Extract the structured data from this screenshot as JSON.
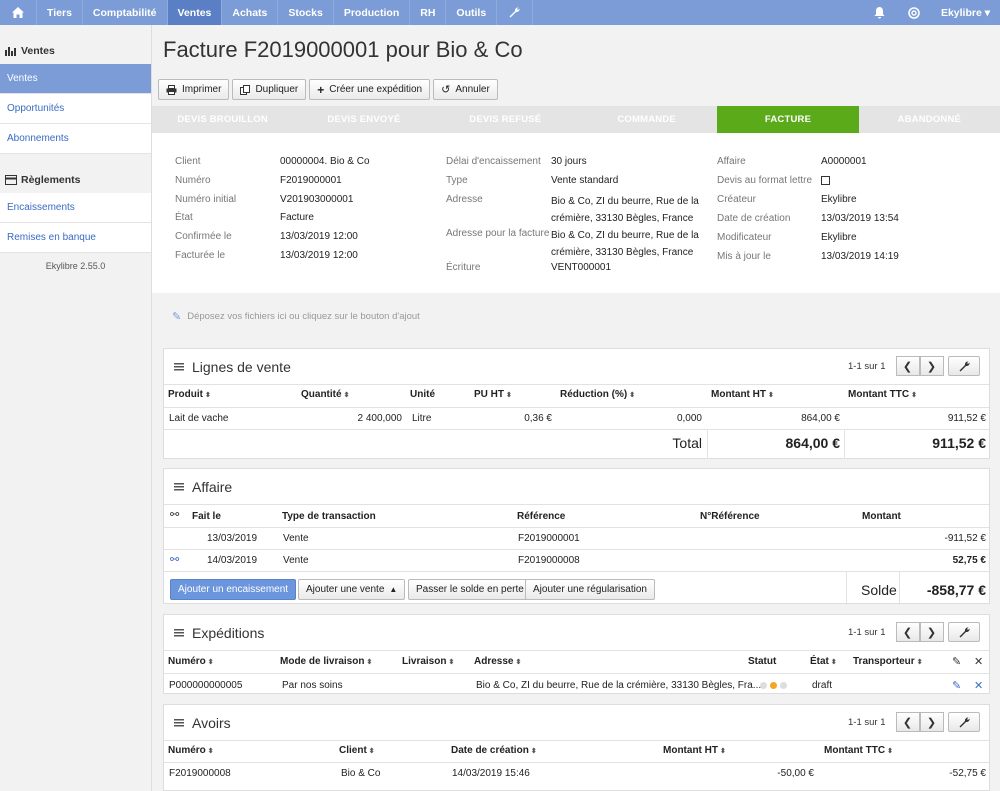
{
  "nav": {
    "items": [
      "Tiers",
      "Comptabilité",
      "Ventes",
      "Achats",
      "Stocks",
      "Production",
      "RH",
      "Outils"
    ],
    "active": "Ventes",
    "user": "Ekylibre"
  },
  "sidebar": {
    "section1": "Ventes",
    "items1": [
      "Ventes",
      "Opportunités",
      "Abonnements"
    ],
    "section2": "Règlements",
    "items2": [
      "Encaissements",
      "Remises en banque"
    ],
    "version": "Ekylibre 2.55.0"
  },
  "page": {
    "title": "Facture F2019000001 pour Bio & Co"
  },
  "toolbar": {
    "print": "Imprimer",
    "duplicate": "Dupliquer",
    "shipment": "Créer une expédition",
    "cancel": "Annuler"
  },
  "steps": [
    "DEVIS BROUILLON",
    "DEVIS ENVOYÉ",
    "DEVIS REFUSÉ",
    "COMMANDE",
    "FACTURE",
    "ABANDONNÉ"
  ],
  "info": {
    "col1": [
      {
        "label": "Client",
        "value": "00000004. Bio & Co",
        "link": true
      },
      {
        "label": "Numéro",
        "value": "F2019000001"
      },
      {
        "label": "Numéro initial",
        "value": "V201903000001"
      },
      {
        "label": "État",
        "value": "Facture"
      },
      {
        "label": "Confirmée le",
        "value": "13/03/2019 12:00"
      },
      {
        "label": "Facturée le",
        "value": "13/03/2019 12:00"
      }
    ],
    "col2": [
      {
        "label": "Délai d'encaissement",
        "value": "30 jours"
      },
      {
        "label": "Type",
        "value": "Vente standard"
      },
      {
        "label": "Adresse",
        "value": "Bio & Co, ZI du beurre, Rue de la",
        "value2": "crémière, 33130 Bègles, France"
      },
      {
        "label": "Adresse pour la facture",
        "value": "Bio & Co, ZI du beurre, Rue de la",
        "value2": "crémière, 33130 Bègles, France"
      },
      {
        "label": "Écriture",
        "value": "VENT000001",
        "link": true
      }
    ],
    "col3": [
      {
        "label": "Affaire",
        "value": "A0000001",
        "link": true
      },
      {
        "label": "Devis au format lettre",
        "value": ""
      },
      {
        "label": "Créateur",
        "value": "Ekylibre"
      },
      {
        "label": "Date de création",
        "value": "13/03/2019 13:54"
      },
      {
        "label": "Modificateur",
        "value": "Ekylibre"
      },
      {
        "label": "Mis à jour le",
        "value": "13/03/2019 14:19"
      }
    ]
  },
  "dropzone": "Déposez vos fichiers ici ou cliquez sur le bouton d'ajout",
  "lignes": {
    "title": "Lignes de vente",
    "pager": "1-1 sur 1",
    "headers": [
      "Produit",
      "Quantité",
      "Unité",
      "PU HT",
      "Réduction (%)",
      "Montant HT",
      "Montant TTC"
    ],
    "row": [
      "Lait de vache",
      "2 400,000",
      "Litre",
      "0,36 €",
      "0,000",
      "864,00 €",
      "911,52 €"
    ],
    "total_label": "Total",
    "total_ht": "864,00 €",
    "total_ttc": "911,52 €"
  },
  "affaire": {
    "title": "Affaire",
    "headers": [
      "Fait le",
      "Type de transaction",
      "Référence",
      "N°Référence",
      "Montant"
    ],
    "rows": [
      {
        "date": "13/03/2019",
        "type": "Vente",
        "ref": "F2019000001",
        "num": "",
        "amount": "-911,52 €",
        "color": "#d22"
      },
      {
        "date": "14/03/2019",
        "type": "Vente",
        "ref": "F2019000008",
        "num": "",
        "amount": "52,75 €",
        "color": "#2a8a2a"
      }
    ],
    "btn_add_payment": "Ajouter un encaissement",
    "btn_add_sale": "Ajouter une vente",
    "btn_loss": "Passer le solde en perte",
    "btn_regul": "Ajouter une régularisation",
    "solde_label": "Solde",
    "solde_value": "-858,77 €"
  },
  "expeditions": {
    "title": "Expéditions",
    "pager": "1-1 sur 1",
    "headers": [
      "Numéro",
      "Mode de livraison",
      "Livraison",
      "Adresse",
      "Statut",
      "État",
      "Transporteur"
    ],
    "row": [
      "P000000000005",
      "Par nos soins",
      "",
      "Bio & Co, ZI du beurre, Rue de la crémière, 33130 Bègles, Fra...",
      "",
      "draft",
      ""
    ]
  },
  "avoirs": {
    "title": "Avoirs",
    "pager": "1-1 sur 1",
    "headers": [
      "Numéro",
      "Client",
      "Date de création",
      "Montant HT",
      "Montant TTC"
    ],
    "row": [
      "F2019000008",
      "Bio & Co",
      "14/03/2019 15:46",
      "-50,00 €",
      "-52,75 €"
    ]
  },
  "colors": {
    "nav": "#7b9cd6",
    "active_step": "#5aaa1a",
    "link": "#3a6bc4"
  }
}
